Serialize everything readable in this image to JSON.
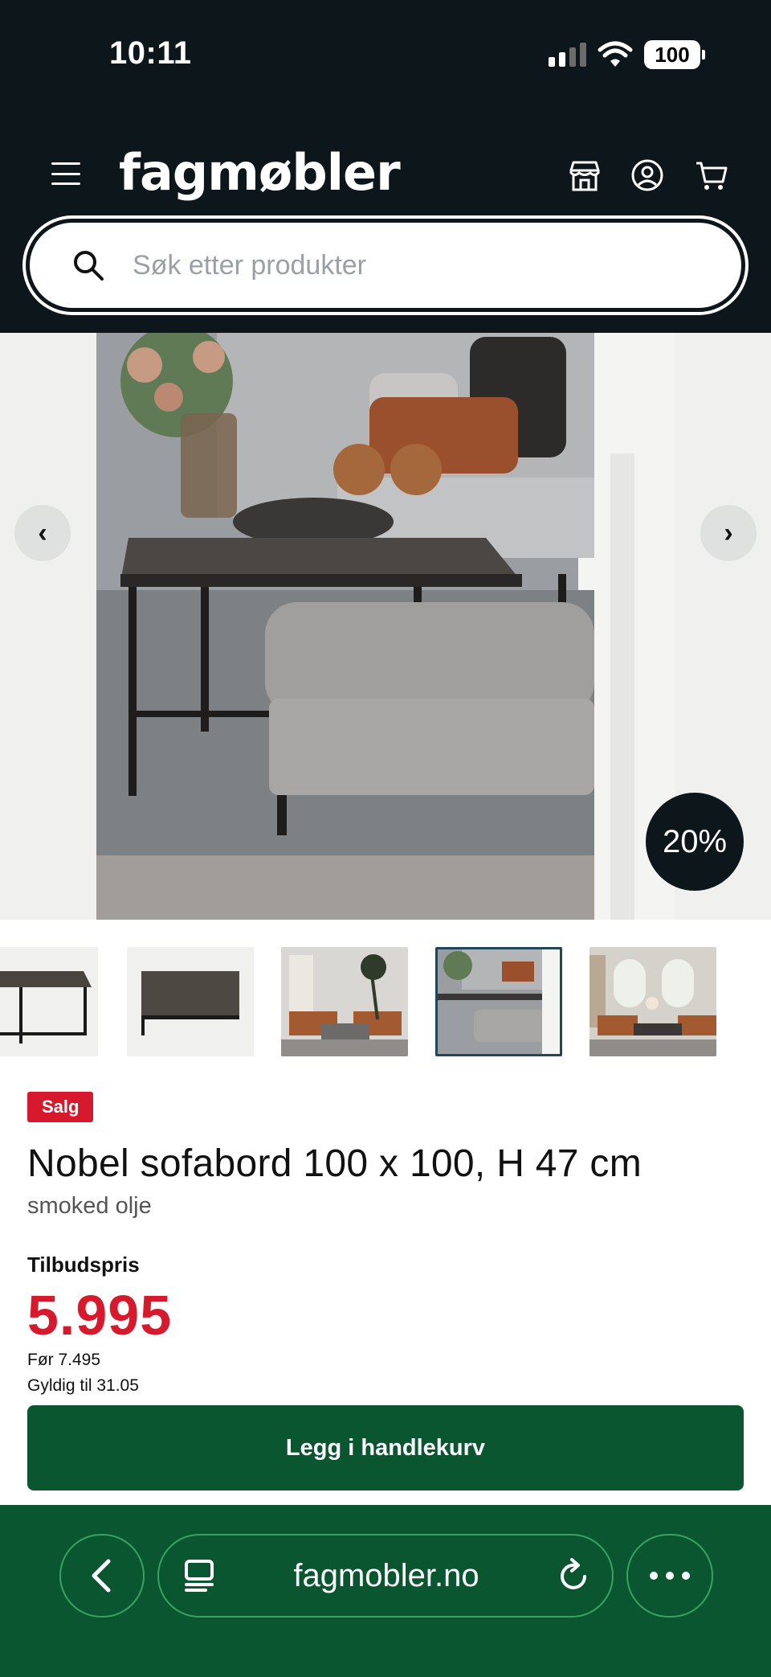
{
  "status_bar": {
    "time": "10:11",
    "battery": "100"
  },
  "header": {
    "logo": "fagmøbler",
    "icons": [
      "menu-icon",
      "store-icon",
      "account-icon",
      "cart-icon"
    ]
  },
  "search": {
    "placeholder": "Søk etter produkter"
  },
  "gallery": {
    "discount_badge": "20%",
    "prev_label": "‹",
    "next_label": "›",
    "thumbnail_count": 5,
    "active_thumbnail": 4
  },
  "product": {
    "badge": "Salg",
    "title": "Nobel sofabord 100 x 100, H 47 cm",
    "subtitle": "smoked olje",
    "price_label": "Tilbudspris",
    "price": "5.995",
    "before_price": "Før 7.495",
    "valid_until": "Gyldig til 31.05"
  },
  "cta": {
    "label": "Legg i handlekurv"
  },
  "browser": {
    "url": "fagmobler.no"
  },
  "colors": {
    "header_bg": "#0c161b",
    "sale_red": "#d7192d",
    "cta_green": "#0a5630"
  }
}
